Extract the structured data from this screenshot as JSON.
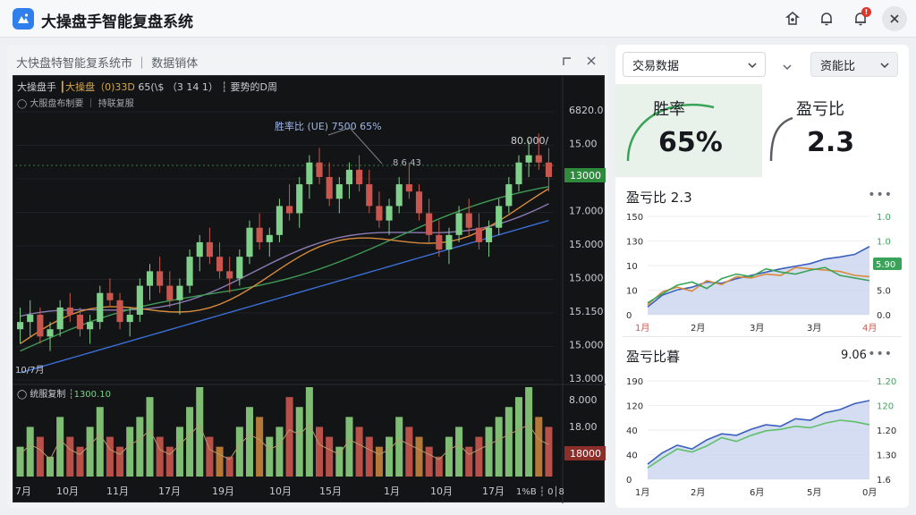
{
  "app": {
    "title": "大操盘手智能复盘系统",
    "notification_count": "!"
  },
  "left_panel": {
    "title": "大快盘特智能复系统市 ｜ 数据销体",
    "legend_name": "大操盘手",
    "legend_price": "┃大操盘（0)33D",
    "legend_rest": "65(\\$ （3 14 1） ┆ 要势的D周",
    "sub_legend": "◯ 大服盘布制要 ｜ 持联复服",
    "annotation_winrate": "胜率比 (UE)   7500  65%",
    "annotation_left_price": "8 6 43",
    "annotation_peak": "80.000/",
    "last_price_tag": "13000",
    "ma_label": "10/7月",
    "vol_legend_a": "◯ 统服复制",
    "vol_legend_b": "┆1300.10",
    "vol_last_tag": "18000",
    "price_ticks": [
      "6820.0",
      "15.00",
      "15000",
      "17.000",
      "15.000",
      "15.000",
      "15.150",
      "15.000",
      "13.000"
    ],
    "vol_ticks": [
      "8.000",
      "18.00"
    ],
    "x_ticks": [
      "7月",
      "10月",
      "11月",
      "17月",
      "19月",
      "10月",
      "15月",
      "1月",
      "10月",
      "17月"
    ],
    "corner_icons_text": "1%B ┆ 0│8"
  },
  "right_panel": {
    "select_trade": "交易数据",
    "select_metric": "资能比",
    "win_rate": {
      "label": "胜率",
      "value": "65%"
    },
    "profit_loss": {
      "label": "盈亏比",
      "value": "2.3"
    },
    "chart1": {
      "title": "盈亏比 2.3",
      "y_left": [
        "150",
        "130",
        "10",
        "10",
        "0"
      ],
      "y_right": [
        "1.0",
        "1.0",
        "5.90",
        "5.0",
        "0.0"
      ],
      "x": [
        "1月",
        "2月",
        "3月",
        "3月",
        "4月"
      ],
      "tag": "5.90"
    },
    "chart2": {
      "title": "盈亏比暮",
      "value": "9.06",
      "y_left": [
        "190",
        "120",
        "40",
        "40",
        "0"
      ],
      "y_right": [
        "1.20",
        "120",
        "1.20",
        "1.30",
        "1.6"
      ],
      "x": [
        "1月",
        "2月",
        "6月",
        "5月",
        "0月"
      ]
    }
  },
  "colors": {
    "up": "#7ed08a",
    "down": "#c9574f",
    "accent": "#2f80ed",
    "ma_blue": "#3b6fd6",
    "ma_green": "#3e9a55",
    "ma_orange": "#d98b3c"
  },
  "icons": [
    "app-logo-icon",
    "theme-icon",
    "bell-icon",
    "alert-bell-icon",
    "close-icon",
    "maximize-icon",
    "panel-close-icon",
    "chevron-down-icon",
    "more-icon"
  ],
  "chart_data": [
    {
      "type": "candlestick",
      "title": "大操盘手",
      "x_ticks": [
        "7月",
        "10月",
        "11月",
        "17月",
        "19月",
        "10月",
        "15月",
        "1月",
        "10月",
        "17月"
      ],
      "ohlc": [
        [
          15.2,
          15.5,
          15.0,
          15.3
        ],
        [
          15.3,
          15.6,
          15.1,
          15.4
        ],
        [
          15.4,
          15.5,
          15.0,
          15.1
        ],
        [
          15.1,
          15.3,
          14.9,
          15.2
        ],
        [
          15.2,
          15.6,
          15.1,
          15.5
        ],
        [
          15.5,
          15.7,
          15.3,
          15.4
        ],
        [
          15.4,
          15.5,
          15.1,
          15.2
        ],
        [
          15.2,
          15.4,
          15.0,
          15.3
        ],
        [
          15.3,
          15.8,
          15.2,
          15.7
        ],
        [
          15.7,
          15.9,
          15.5,
          15.6
        ],
        [
          15.6,
          15.7,
          15.2,
          15.3
        ],
        [
          15.3,
          15.5,
          15.1,
          15.4
        ],
        [
          15.4,
          15.9,
          15.3,
          15.8
        ],
        [
          15.8,
          16.1,
          15.6,
          16.0
        ],
        [
          16.0,
          16.2,
          15.7,
          15.8
        ],
        [
          15.8,
          16.0,
          15.5,
          15.6
        ],
        [
          15.6,
          15.9,
          15.4,
          15.8
        ],
        [
          15.8,
          16.3,
          15.7,
          16.2
        ],
        [
          16.2,
          16.5,
          16.0,
          16.4
        ],
        [
          16.4,
          16.6,
          16.1,
          16.2
        ],
        [
          16.2,
          16.4,
          15.9,
          16.0
        ],
        [
          16.0,
          16.2,
          15.7,
          15.9
        ],
        [
          15.9,
          16.3,
          15.8,
          16.2
        ],
        [
          16.2,
          16.7,
          16.1,
          16.6
        ],
        [
          16.6,
          16.8,
          16.3,
          16.4
        ],
        [
          16.4,
          16.6,
          16.2,
          16.5
        ],
        [
          16.5,
          17.0,
          16.4,
          16.9
        ],
        [
          16.9,
          17.2,
          16.7,
          16.8
        ],
        [
          16.8,
          17.3,
          16.6,
          17.2
        ],
        [
          17.2,
          17.6,
          17.0,
          17.5
        ],
        [
          17.5,
          17.7,
          17.2,
          17.3
        ],
        [
          17.3,
          17.5,
          16.9,
          17.0
        ],
        [
          17.0,
          17.3,
          16.8,
          17.2
        ],
        [
          17.2,
          17.5,
          17.0,
          17.4
        ],
        [
          17.4,
          17.6,
          17.1,
          17.2
        ],
        [
          17.2,
          17.4,
          16.8,
          16.9
        ],
        [
          16.9,
          17.1,
          16.6,
          16.7
        ],
        [
          16.7,
          17.0,
          16.5,
          16.9
        ],
        [
          16.9,
          17.3,
          16.8,
          17.2
        ],
        [
          17.2,
          17.5,
          17.0,
          17.1
        ],
        [
          17.1,
          17.2,
          16.7,
          16.8
        ],
        [
          16.8,
          17.0,
          16.4,
          16.5
        ],
        [
          16.5,
          16.7,
          16.2,
          16.3
        ],
        [
          16.3,
          16.6,
          16.1,
          16.5
        ],
        [
          16.5,
          16.9,
          16.4,
          16.8
        ],
        [
          16.8,
          17.0,
          16.5,
          16.6
        ],
        [
          16.6,
          16.8,
          16.3,
          16.4
        ],
        [
          16.4,
          16.7,
          16.2,
          16.6
        ],
        [
          16.6,
          17.0,
          16.5,
          16.9
        ],
        [
          16.9,
          17.3,
          16.8,
          17.2
        ],
        [
          17.2,
          17.6,
          17.1,
          17.5
        ],
        [
          17.5,
          17.8,
          17.3,
          17.6
        ],
        [
          17.6,
          17.9,
          17.4,
          17.5
        ],
        [
          17.5,
          17.7,
          17.1,
          17.3
        ]
      ],
      "volume": [
        3,
        5,
        4,
        2,
        6,
        4,
        3,
        5,
        7,
        4,
        3,
        5,
        6,
        8,
        4,
        3,
        5,
        7,
        9,
        4,
        3,
        2,
        5,
        7,
        6,
        4,
        5,
        8,
        7,
        9,
        5,
        4,
        3,
        6,
        5,
        4,
        3,
        4,
        6,
        5,
        4,
        3,
        2,
        4,
        5,
        3,
        4,
        5,
        6,
        7,
        8,
        9,
        6,
        5
      ],
      "ylim": [
        14.5,
        18.2
      ],
      "last_price": "13000"
    },
    {
      "type": "line",
      "title": "盈亏比 2.3",
      "categories": [
        "1月",
        "2月",
        "3月",
        "3月",
        "4月"
      ],
      "series": [
        {
          "values": [
            12,
            30,
            38,
            42,
            50,
            48,
            55,
            60,
            65,
            70,
            74,
            78,
            85,
            88,
            92,
            104
          ]
        },
        {
          "values": [
            15,
            35,
            42,
            36,
            52,
            46,
            58,
            56,
            62,
            60,
            72,
            70,
            68,
            66,
            60,
            58
          ]
        },
        {
          "values": [
            18,
            32,
            45,
            50,
            40,
            55,
            62,
            58,
            70,
            65,
            62,
            68,
            72,
            60,
            56,
            52
          ]
        }
      ],
      "ylim": [
        0,
        150
      ]
    },
    {
      "type": "area",
      "title": "盈亏比暮",
      "categories": [
        "1月",
        "2月",
        "6月",
        "5月",
        "0月"
      ],
      "series": [
        {
          "values": [
            20,
            35,
            45,
            40,
            52,
            60,
            58,
            66,
            72,
            70,
            80,
            78,
            88,
            92,
            100,
            104
          ]
        },
        {
          "values": [
            15,
            28,
            40,
            36,
            44,
            55,
            50,
            58,
            64,
            66,
            70,
            68,
            74,
            78,
            76,
            72
          ]
        }
      ],
      "ylim": [
        0,
        130
      ]
    }
  ]
}
